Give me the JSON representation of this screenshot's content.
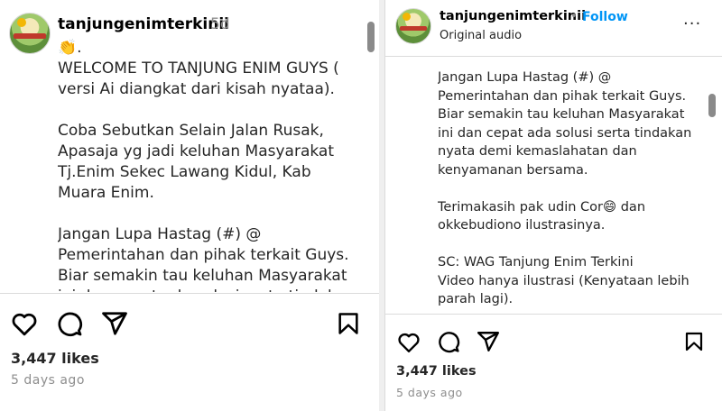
{
  "left": {
    "username": "tanjungenimterkinii",
    "time": "5d",
    "caption": "👏.\nWELCOME TO TANJUNG ENIM GUYS ( versi Ai diangkat dari kisah nyataa).\n\nCoba Sebutkan Selain Jalan Rusak, Apasaja yg jadi keluhan Masyarakat Tj.Enim Sekec Lawang Kidul, Kab Muara Enim.\n\nJangan Lupa Hastag (#) @ Pemerintahan dan pihak terkait Guys. Biar semakin tau keluhan Masyarakat ini dan cepat ada solusi serta tindakan",
    "likes": "3,447 likes",
    "ago": "5 days ago",
    "icons": {
      "avatar": "profile-avatar",
      "more": "more-options-icon",
      "like": "heart-icon",
      "comment": "comment-icon",
      "share": "share-icon",
      "save": "bookmark-icon"
    }
  },
  "right": {
    "username": "tanjungenimterkinii",
    "follow": "Follow",
    "separator": "•",
    "audio": "Original audio",
    "caption": "Jangan Lupa Hastag (#) @ Pemerintahan dan pihak terkait Guys. Biar semakin tau keluhan Masyarakat ini dan cepat ada solusi serta tindakan nyata demi kemaslahatan dan kenyamanan bersama.\n\nTerimakasih pak udin Cor😄 dan okkebudiono ilustrasinya.\n\nSC: WAG Tanjung Enim Terkini\nVideo hanya ilustrasi (Kenyataan lebih parah lagi).",
    "likes": "3,447 likes",
    "ago": "5 days ago",
    "more": "···"
  },
  "colors": {
    "link": "#0095f6",
    "muted": "#8e8e8e",
    "border": "#dbdbdb",
    "text": "#262626"
  }
}
